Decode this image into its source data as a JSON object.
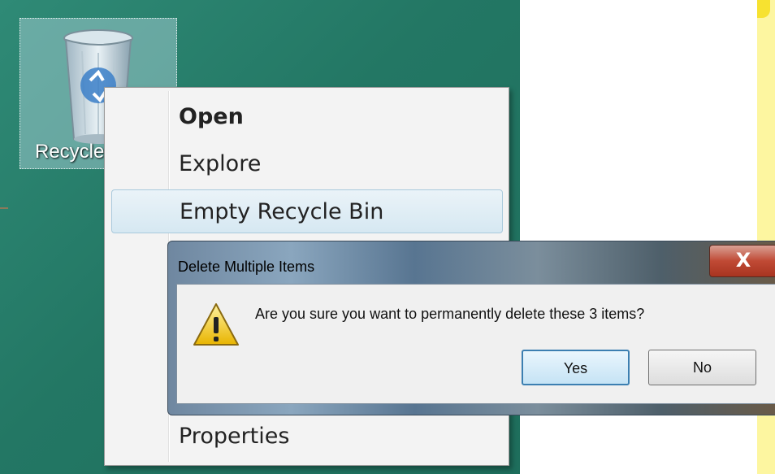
{
  "desktop": {
    "recycle_bin_label": "Recycle Bin"
  },
  "context_menu": {
    "items": [
      {
        "label": "Open",
        "bold": true
      },
      {
        "label": "Explore",
        "bold": false
      },
      {
        "label": "Empty Recycle Bin",
        "highlighted": true
      },
      {
        "label": "Properties",
        "bold": false
      }
    ]
  },
  "dialog": {
    "title": "Delete Multiple Items",
    "close_label": "X",
    "message": "Are you sure you want to permanently delete these 3 items?",
    "yes_label": "Yes",
    "no_label": "No",
    "icon": "warning-icon"
  },
  "colors": {
    "desktop": "#237764",
    "menu_highlight": "#d6e8f2",
    "close_button": "#c04a35"
  }
}
